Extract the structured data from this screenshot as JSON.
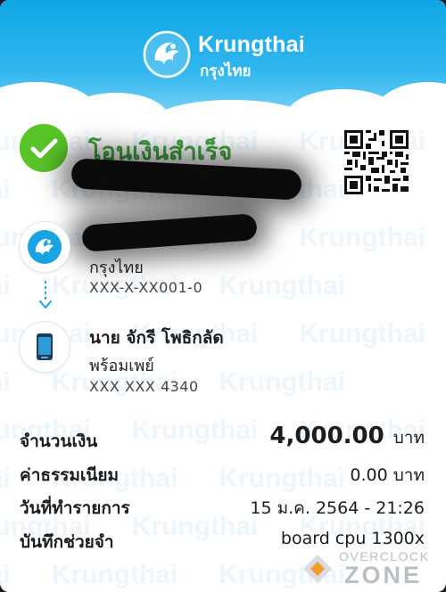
{
  "header": {
    "brand_en": "Krungthai",
    "brand_th": "กรุงไทย",
    "colors": {
      "sky": "#0fa6e6",
      "cloud": "#ffffff"
    },
    "logo_icon": "krungthai-phoenix-icon"
  },
  "watermark_text": "Krungthai",
  "status": {
    "title": "โอนเงินสำเร็จ",
    "icon": "check-circle-icon",
    "color": "#58c428"
  },
  "qr_icon": "qr-code-icon",
  "sender": {
    "bank_name": "กรุงไทย",
    "account": "XXX-X-XX001-0",
    "icon": "krungthai-bank-icon"
  },
  "receiver": {
    "name": "นาย จักรี โพธิกลัด",
    "service": "พร้อมเพย์",
    "account": "XXX XXX 4340",
    "icon": "mobile-phone-icon"
  },
  "details": {
    "amount_label": "จำนวนเงิน",
    "amount_value": "4,000.00",
    "amount_unit": "บาท",
    "fee_label": "ค่าธรรมเนียม",
    "fee_value": "0.00 บาท",
    "date_label": "วันที่ทำรายการ",
    "date_value": "15 ม.ค. 2564 - 21:26",
    "memo_label": "บันทึกช่วยจำ",
    "memo_value": "board cpu 1300x"
  },
  "overlay_logo": {
    "line1": "OVERCLOCK",
    "line2": "ZONE"
  }
}
